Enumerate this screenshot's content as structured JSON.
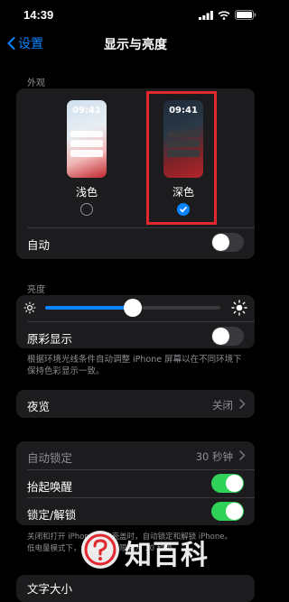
{
  "status_bar": {
    "time": "14:39"
  },
  "nav": {
    "back_label": "设置",
    "title": "显示与亮度"
  },
  "appearance": {
    "section_label": "外观",
    "options": [
      {
        "label": "浅色",
        "clock": "09:41",
        "selected": false
      },
      {
        "label": "深色",
        "clock": "09:41",
        "selected": true
      }
    ],
    "auto_label": "自动",
    "auto_on": false
  },
  "brightness": {
    "section_label": "亮度",
    "level": 0.5,
    "true_tone_label": "原彩显示",
    "true_tone_on": false,
    "footer": "根据环境光线条件自动调整 iPhone 屏幕以在不同环境下保持色彩显示一致。"
  },
  "night_shift": {
    "label": "夜览",
    "value": "关闭"
  },
  "lock": {
    "auto_lock_label": "自动锁定",
    "auto_lock_value": "30 秒钟",
    "raise_to_wake_label": "抬起唤醒",
    "raise_to_wake_on": true,
    "lock_unlock_label": "锁定/解锁",
    "lock_unlock_on": true,
    "footer_line1": "关闭和打开 iPhone 保护壳盖时，自动锁定和解锁 iPhone。",
    "footer_line2": "低电量模式下，自动锁定将限制为 30 秒钟。"
  },
  "next_row_label": "文字大小",
  "watermark": {
    "text": "知百科"
  },
  "colors": {
    "accent": "#0a84ff",
    "toggle_on": "#30d158",
    "highlight": "#e0282e"
  }
}
